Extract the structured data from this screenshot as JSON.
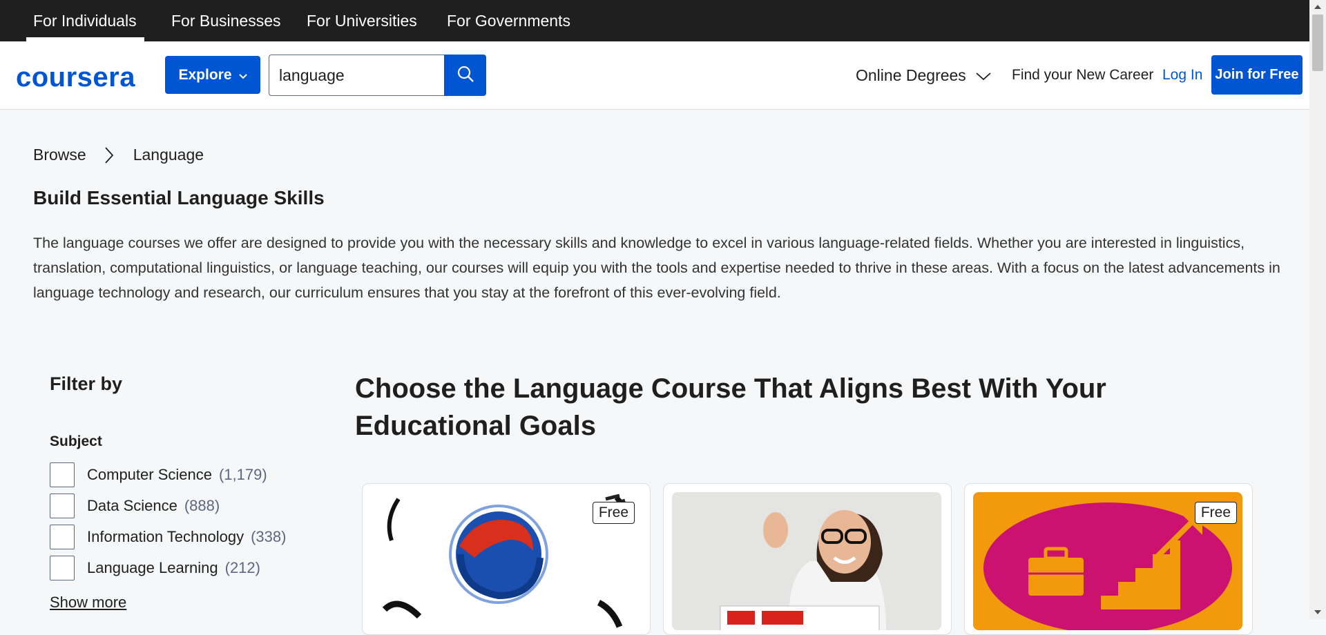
{
  "audience_tabs": [
    {
      "label": "For Individuals",
      "active": true
    },
    {
      "label": "For Businesses"
    },
    {
      "label": "For Universities"
    },
    {
      "label": "For Governments"
    }
  ],
  "header": {
    "logo": "coursera",
    "explore_label": "Explore",
    "search_value": "language",
    "online_degrees": "Online Degrees",
    "find_career": "Find your New Career",
    "login": "Log In",
    "join": "Join for Free"
  },
  "breadcrumb": [
    "Browse",
    "Language"
  ],
  "page": {
    "title": "Build Essential Language Skills",
    "description": "The language courses we offer are designed to provide you with the necessary skills and knowledge to excel in various language-related fields. Whether you are interested in linguistics, translation, computational linguistics, or language teaching, our courses will equip you with the tools and expertise needed to thrive in these areas. With a focus on the latest advancements in language technology and research, our curriculum ensures that you stay at the forefront of this ever-evolving field."
  },
  "filters": {
    "title": "Filter by",
    "subject_title": "Subject",
    "options": [
      {
        "label": "Computer Science",
        "count": "(1,179)",
        "checked": false
      },
      {
        "label": "Data Science",
        "count": "(888)",
        "checked": false
      },
      {
        "label": "Information Technology",
        "count": "(338)",
        "checked": false
      },
      {
        "label": "Language Learning",
        "count": "(212)",
        "checked": false
      }
    ],
    "show_more": "Show more"
  },
  "main": {
    "section_title": "Choose the Language Course That Aligns Best With Your Educational Goals"
  },
  "cards": [
    {
      "badge": "Free",
      "image": "korean-taegeuk-brush-image"
    },
    {
      "badge": "",
      "image": "woman-with-glasses-holding-sign-image"
    },
    {
      "badge": "Free",
      "image": "career-stairs-briefcase-image"
    }
  ],
  "colors": {
    "brand": "#0056d2",
    "top_bar": "#1f1f1f",
    "page_bg": "#f5f7f8"
  }
}
